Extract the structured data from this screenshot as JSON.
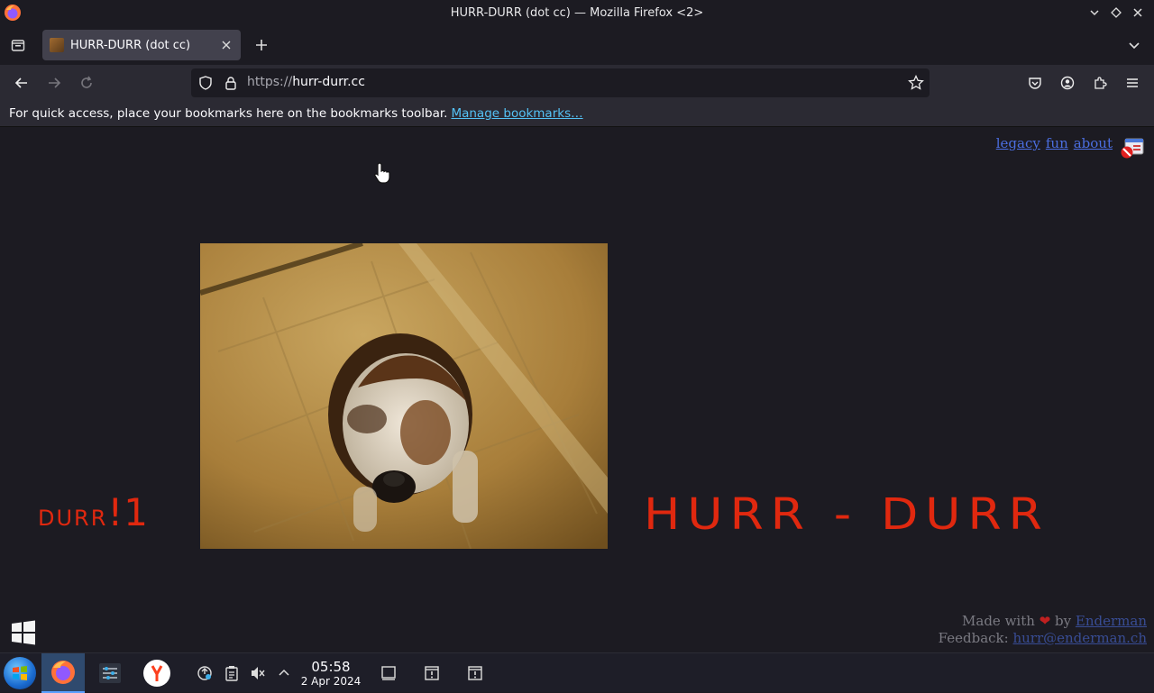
{
  "window": {
    "title": "HURR-DURR (dot cc) — Mozilla Firefox <2>"
  },
  "tabs": [
    {
      "title": "HURR-DURR (dot cc)"
    }
  ],
  "urlbar": {
    "scheme": "https://",
    "host": "hurr-durr.cc"
  },
  "bookmarks": {
    "message": "For quick access, place your bookmarks here on the bookmarks toolbar.",
    "manage_link": "Manage bookmarks…"
  },
  "page": {
    "links": [
      "legacy",
      "fun",
      "about"
    ],
    "durr_lower": "durr",
    "durr_suffix": "!1",
    "hurr_durr": "HURR - DURR",
    "footer": {
      "made_with": "Made with",
      "by": "by",
      "author": "Enderman",
      "feedback_label": "Feedback:",
      "feedback_email": "hurr@enderman.ch"
    }
  },
  "taskbar": {
    "time": "05:58",
    "date": "2 Apr 2024"
  },
  "colors": {
    "accent_red": "#e0280f",
    "link_blue": "#4b6ee0",
    "toolbar_link": "#54c2f5"
  }
}
